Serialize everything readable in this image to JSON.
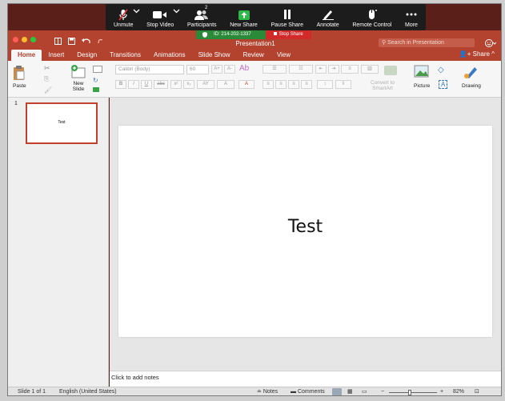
{
  "zoom_toolbar": {
    "unmute": "Unmute",
    "stop_video": "Stop Video",
    "participants": "Participants",
    "participants_count": "2",
    "new_share": "New Share",
    "pause_share": "Pause Share",
    "annotate": "Annotate",
    "remote_control": "Remote Control",
    "more": "More"
  },
  "share_strip": {
    "meeting_id": "ID: 214-202-1337",
    "stop_share": "Stop Share"
  },
  "window": {
    "title": "Presentation1",
    "search_placeholder": "Search in Presentation"
  },
  "tabs": [
    "Home",
    "Insert",
    "Design",
    "Transitions",
    "Animations",
    "Slide Show",
    "Review",
    "View"
  ],
  "share_label": "Share",
  "ribbon": {
    "paste": "Paste",
    "new_slide": "New",
    "new_slide_2": "Slide",
    "font_name": "Calibri (Body)",
    "font_size": "60",
    "convert_smartart_1": "Convert to",
    "convert_smartart_2": "SmartArt",
    "picture": "Picture",
    "drawing": "Drawing",
    "bold": "B",
    "italic": "I",
    "underline": "U",
    "strike": "abc",
    "superscript": "x²",
    "subscript": "x₂"
  },
  "thumbnails": [
    {
      "number": "1",
      "text": "Test"
    }
  ],
  "slide": {
    "title": "Test"
  },
  "notes_placeholder": "Click to add notes",
  "status": {
    "slide_count": "Slide 1 of 1",
    "language": "English (United States)",
    "notes": "Notes",
    "comments": "Comments",
    "zoom": "82%"
  },
  "colors": {
    "accent": "#b3422f",
    "zoom_bar": "#1c1c1c",
    "id_green": "#2a8a3a",
    "stop_red": "#d22a2a"
  }
}
